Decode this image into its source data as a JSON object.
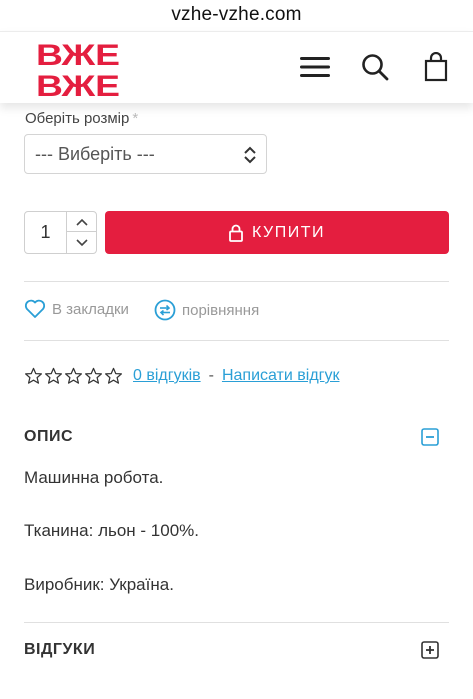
{
  "browser": {
    "url": "vzhe-vzhe.com"
  },
  "header": {
    "logo_text": [
      "ВЖЕ",
      "ВЖЕ"
    ],
    "logo_color": "#e41e3f",
    "icons": [
      "menu-icon",
      "search-icon",
      "shopping-bag-icon"
    ]
  },
  "product": {
    "size_label": "Оберіть розмір",
    "size_required_mark": "*",
    "size_select_value": "--- Виберіть ---",
    "quantity": "1",
    "buy_label": "КУПИТИ",
    "buy_color": "#e41e3f"
  },
  "actions": {
    "wishlist_label": "В закладки",
    "compare_label": "порівняння"
  },
  "rating": {
    "stars": 0,
    "max_stars": 5,
    "reviews_link": "0 відгуків",
    "separator": "-",
    "write_review_link": "Написати відгук",
    "link_color": "#2a9fd6"
  },
  "description": {
    "title": "ОПИС",
    "lines": [
      "Машинна робота.",
      "Тканина: льон - 100%.",
      "Виробник: Україна."
    ]
  },
  "reviews": {
    "title": "ВІДГУКИ"
  }
}
